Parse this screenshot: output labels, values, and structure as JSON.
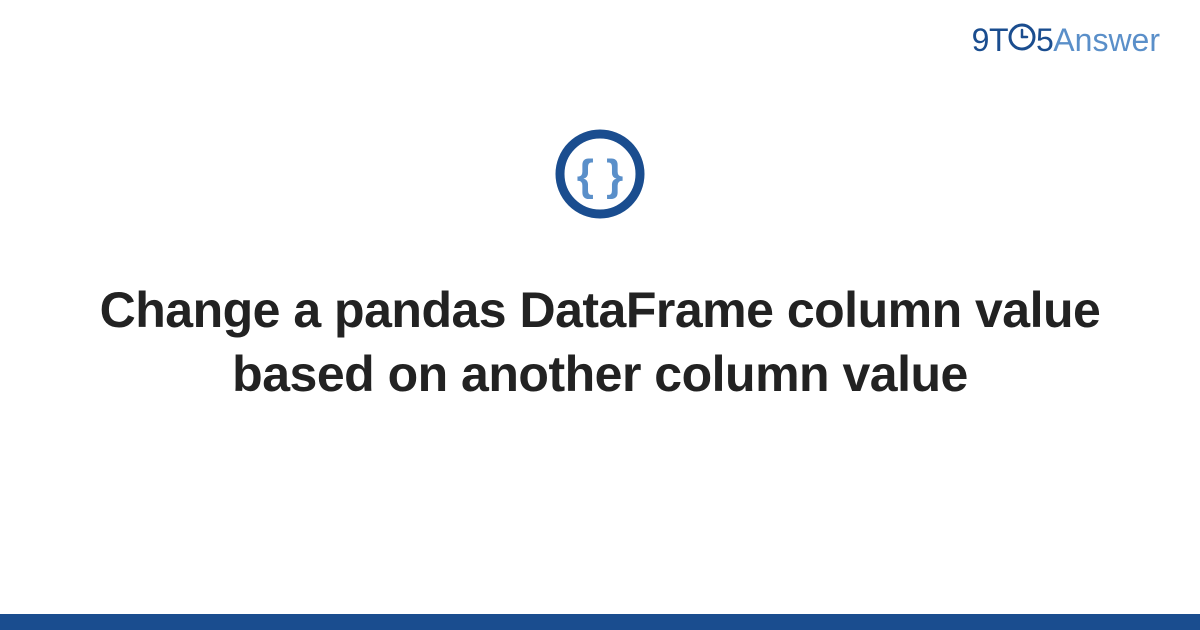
{
  "logo": {
    "prefix": "9T",
    "middle": "5",
    "suffix": "Answer"
  },
  "title": "Change a pandas DataFrame column value based on another column value",
  "colors": {
    "dark_blue": "#1a4d8f",
    "light_blue": "#5a8fc9",
    "text": "#222222"
  }
}
